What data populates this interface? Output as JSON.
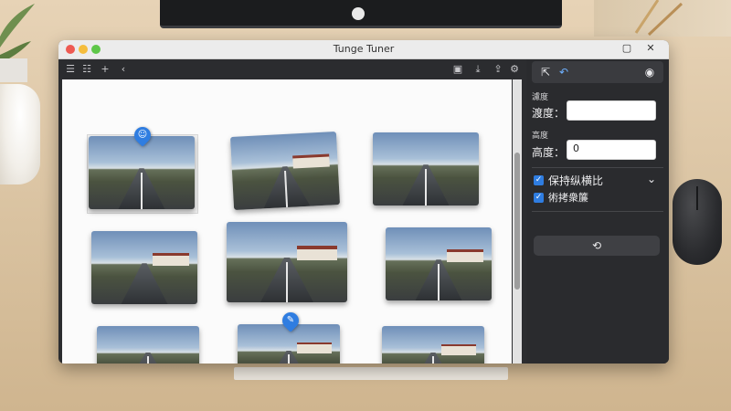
{
  "window": {
    "title": "Tunge Tuner",
    "close_glyph": "✕",
    "maximize_glyph": "▢"
  },
  "toolbar": {
    "left_icons": [
      "list-icon",
      "list-numbered-icon",
      "plus-icon",
      "back-icon"
    ],
    "right_icons": [
      "image-icon",
      "download-icon",
      "share-icon",
      "settings-icon"
    ]
  },
  "gallery": {
    "thumbnails": [
      {
        "label": ""
      },
      {
        "label": ""
      },
      {
        "label": ""
      },
      {
        "label": ""
      },
      {
        "label": ""
      },
      {
        "label": ""
      },
      {
        "label": ""
      },
      {
        "label": ""
      },
      {
        "label": ""
      }
    ],
    "pins": [
      {
        "glyph": "☺",
        "icon": "smile-pin-icon"
      },
      {
        "glyph": "✎",
        "icon": "edit-pin-icon"
      }
    ]
  },
  "panel": {
    "width_caption": "濾度",
    "width_label": "渡度：",
    "width_value": "",
    "height_caption": "高度",
    "height_label": "高度：",
    "height_value": "0",
    "keep_aspect_label": "保持纵横比",
    "second_check_label": "術拷衆簾",
    "action_glyph": "⟲",
    "colors": {
      "accent": "#2f7de1",
      "panel_bg": "#2a2b2e"
    }
  }
}
